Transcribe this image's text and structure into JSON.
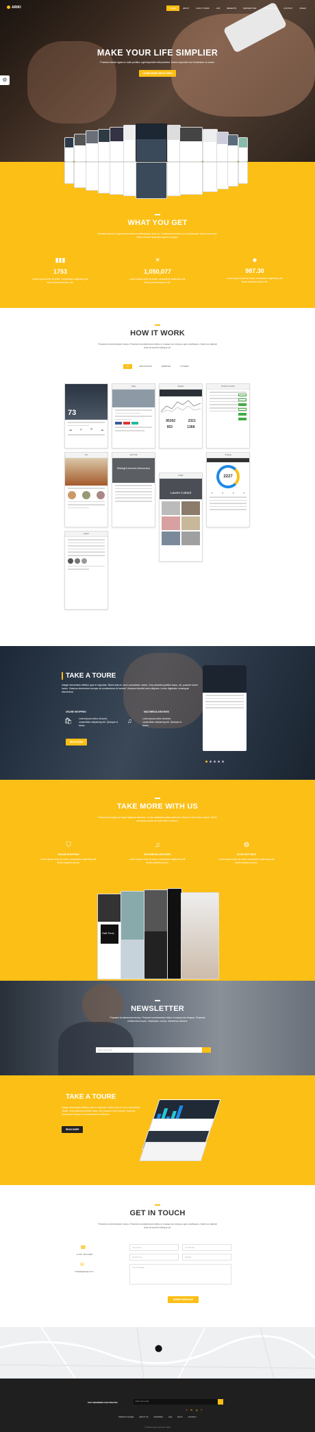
{
  "nav": {
    "logo": "ARIKI",
    "items": [
      "HOME",
      "ABOUT",
      "HOW IT WORK",
      "APP",
      "BENEFITS",
      "NEWSLETTER",
      "TAKE A TOURE",
      "CONTACT",
      "PAGES"
    ]
  },
  "hero": {
    "title": "MAKE YOUR LIFE SIMPLIER",
    "text": "Praesent iaculis ligula eu nulla porttitor, eget imperdiet velit pharetra. Donec imperdiet orci fermentum ut ornare.",
    "button": "LEARN MORE ABOUT ARIKI"
  },
  "wyg": {
    "title": "WHAT YOU GET",
    "text": "Praesent iaculis ut ligula fermentum at pellentesque dolor at. Condimentum lorem ut at ullamcorper lorem commodo. Etiam sit amet imperdiet ligula ut tempor.",
    "stats": [
      {
        "icon": "bar-chart-icon",
        "num": "1753",
        "text": "Lorem ipsum dolor sit amet, consectetur adipiscing elit. Morbi pharetra auctor elit."
      },
      {
        "icon": "sun-icon",
        "num": "1,050,077",
        "text": "Lorem ipsum dolor sit amet, consectetur adipiscing elit. Morbi pharetra auctor elit."
      },
      {
        "icon": "users-icon",
        "num": "987.30",
        "text": "Lorem ipsum dolor sit amet, consectetur adipiscing elit. Morbi pharetra auctor elit."
      }
    ]
  },
  "how": {
    "title": "HOW IT WORK",
    "text": "Praesent at elementum lectus. Praesent condimentum tellus in massa nec tempus quis vestibulum. Morbi ac blandit ante at laoreet tristique sit.",
    "filters": [
      "ALL",
      "APPLICATIONS",
      "WEBSITES",
      "SYSTEMS"
    ],
    "cards": [
      "Weather",
      "Video",
      "Statistic",
      "Social Connection",
      "Info",
      "Call Trunk",
      "Profile",
      "Tracking",
      "Search"
    ],
    "weather_temp": "73",
    "stat_a": "95302",
    "stat_b": "2321",
    "stat_c": "953",
    "stat_d": "1368",
    "tracking_num": "2227",
    "media_text": "Midsight Access Mementos",
    "profile_name": "Lauren Cottard"
  },
  "toure": {
    "title": "TAKE A TOURE",
    "text": "Integer elementum efficitur quis et vulputate. Morbi ante et, nunc consectetur varius. Cras pharetra porttitor lacus, vel, posuere lorem luctus. Vivamus elementum semper at condimentum id laoreet. Vivamus lobortis lorem aliquam. Lorem dignissim consequat elementum.",
    "f1_title": "ONLINE SHOPPING",
    "f1_text": "Lorem ipsum dolor sit amet, consectetur adipiscing elit. Quisque ut lorem.",
    "f2_title": "MULTIMEDIA ARCHIVES",
    "f2_text": "Lorem ipsum dolor sit amet, consectetur adipiscing elit. Quisque ut lorem.",
    "button": "READ MORE"
  },
  "more": {
    "title": "TAKE MORE WITH US",
    "text": "Praesent at magna at neque aliquam interdum. In hac habitasse platea dictumst. Mauris ut fermentum ipsum. Etiam accumsan lectus sit amet libero rhoncus.",
    "items": [
      {
        "icon": "bag-icon",
        "title": "ONLINE SHOPPING",
        "text": "Lorem ipsum dolor sit amet, consectetur adipiscing elit. Morbi pharetra auctor."
      },
      {
        "icon": "music-icon",
        "title": "MULTIMEDIA ARCHIVES",
        "text": "Lorem ipsum dolor sit amet, consectetur adipiscing elit. Morbi pharetra auctor."
      },
      {
        "icon": "gear-icon",
        "title": "GOOD SETTINGS",
        "text": "Lorem ipsum dolor sit amet, consectetur adipiscing elit. Morbi pharetra auctor."
      }
    ],
    "album": "Daft Punk"
  },
  "news": {
    "title": "NEWSLETTER",
    "text": "Praesent at elementum lectus. Praesent condimentum tellus in massa nec tempus. Praesent ut bibendum turpis. Vestibulum cursus, elementum laoreet.",
    "placeholder": "Enter your email"
  },
  "toure2": {
    "title": "TAKE A TOURE",
    "text": "Integer elementum efficitur quis et vulputate. Morbi ante et, nunc consectetur varius. Cras pharetra porttitor lacus, vel, posuere lorem luctus. Vivamus elementum semper at condimentum id laoreet.",
    "button": "READ MORE"
  },
  "contact": {
    "title": "GET IN TOUCH",
    "text": "Praesent at elementum lectus. Praesent condimentum tellus in massa nec tempus quis vestibulum. Morbi ac blandit ante at laoreet tristique sit.",
    "phone": "+1 567 7844 2345",
    "email": "hello@agileapp.com",
    "name_ph": "Your name",
    "email_ph": "Your Email",
    "phone_ph": "Your Phone",
    "subject_ph": "Subject",
    "message_ph": "Your message",
    "button": "SUBMIT MESSAGE"
  },
  "footer": {
    "stay": "STAY INFORMED OUR UPDATES",
    "email_ph": "Enter your email",
    "links": [
      "PRODUCT PAGES",
      "ABOUT US",
      "SHOPPING",
      "FAQ",
      "BLOG",
      "CONTACT"
    ],
    "copy": "© 2015 Ali rights reserved. ARIKI"
  }
}
